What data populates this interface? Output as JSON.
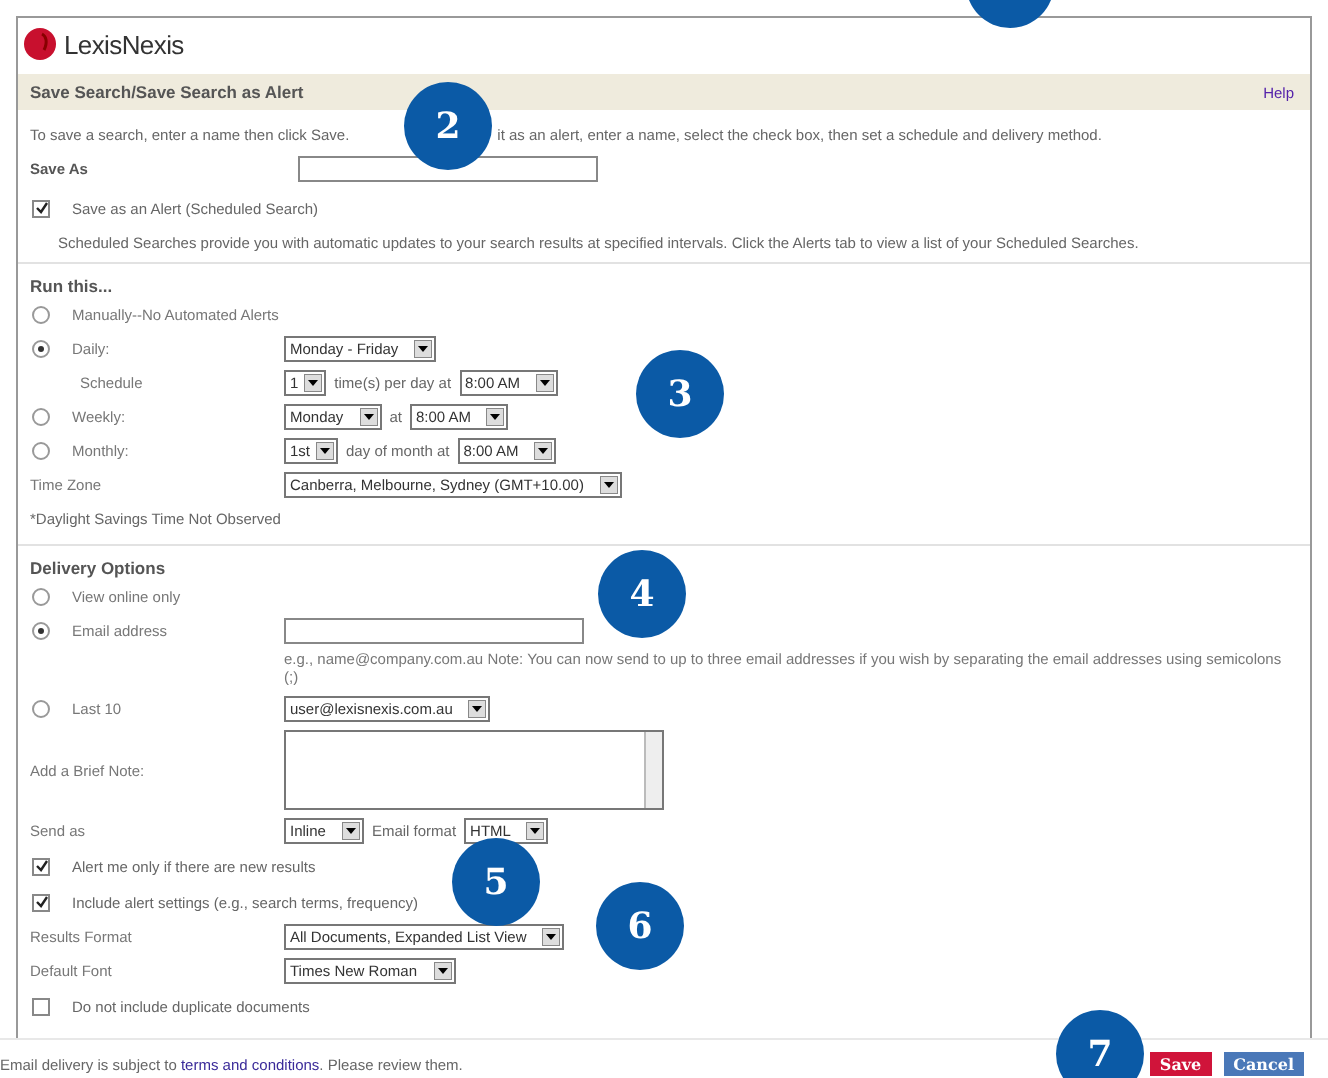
{
  "logo": {
    "text": "LexisNexis"
  },
  "header": {
    "title": "Save Search/Save Search as Alert",
    "help": "Help"
  },
  "intro": [
    "To save a search, enter a name then click Save.",
    "it as an alert, enter a name, select the check box, then set a schedule and delivery method."
  ],
  "save_as": {
    "label": "Save As"
  },
  "alert_checkbox": {
    "label": "Save as an Alert (Scheduled Search)",
    "checked": true
  },
  "alert_description": "Scheduled Searches provide you with automatic updates to your search results at specified intervals. Click the Alerts tab to view a list of your Scheduled Searches.",
  "run_this": {
    "heading": "Run this...",
    "rows": [
      {
        "kind": "radio",
        "label": "Manually--No Automated Alerts",
        "selected": false
      },
      {
        "kind": "radio",
        "label": "Daily:",
        "selected": true,
        "controls": [
          {
            "kind": "select",
            "value": "Monday - Friday"
          }
        ]
      },
      {
        "kind": "subfield",
        "label": "Schedule",
        "controls": [
          {
            "kind": "select",
            "value": "1"
          },
          {
            "kind": "text",
            "text": "time(s) per day at"
          },
          {
            "kind": "select",
            "value": "8:00 AM"
          }
        ]
      },
      {
        "kind": "radio",
        "label": "Weekly:",
        "selected": false,
        "controls": [
          {
            "kind": "select",
            "value": "Monday"
          },
          {
            "kind": "text",
            "text": "at"
          },
          {
            "kind": "select",
            "value": "8:00 AM"
          }
        ]
      },
      {
        "kind": "radio",
        "label": "Monthly:",
        "selected": false,
        "controls": [
          {
            "kind": "select",
            "value": "1st"
          },
          {
            "kind": "text",
            "text": "day of month at"
          },
          {
            "kind": "select",
            "value": "8:00 AM"
          }
        ]
      },
      {
        "kind": "field",
        "label": "Time Zone",
        "controls": [
          {
            "kind": "select",
            "value": "Canberra, Melbourne, Sydney (GMT+10.00)"
          }
        ]
      },
      {
        "kind": "note",
        "text": "*Daylight Savings Time Not Observed"
      }
    ]
  },
  "delivery": {
    "heading": "Delivery Options",
    "rows": [
      {
        "kind": "radio",
        "label": "View online only",
        "selected": false
      },
      {
        "kind": "radio",
        "label": "Email address",
        "selected": true,
        "controls": [
          {
            "kind": "input"
          }
        ]
      },
      {
        "kind": "hint",
        "text": "e.g., name@company.com.au Note: You can now send to up to three email addresses if you wish by separating the email addresses using semicolons (;)"
      },
      {
        "kind": "radio",
        "label": "Last 10",
        "selected": false,
        "controls": [
          {
            "kind": "select",
            "value": "user@lexisnexis.com.au"
          }
        ]
      },
      {
        "kind": "field",
        "label": "Add a Brief Note:",
        "controls": [
          {
            "kind": "textarea"
          }
        ]
      },
      {
        "kind": "field",
        "label": "Send as",
        "controls": [
          {
            "kind": "select",
            "value": "Inline"
          },
          {
            "kind": "text",
            "text": "Email format"
          },
          {
            "kind": "select",
            "value": "HTML"
          }
        ]
      },
      {
        "kind": "checkbox",
        "label": "Alert me only if there are new results",
        "checked": true
      },
      {
        "kind": "checkbox",
        "label": "Include alert settings (e.g., search terms, frequency)",
        "checked": true
      },
      {
        "kind": "field",
        "label": "Results Format",
        "controls": [
          {
            "kind": "select",
            "value": "All Documents, Expanded List View"
          }
        ]
      },
      {
        "kind": "field",
        "label": "Default Font",
        "controls": [
          {
            "kind": "select",
            "value": "Times New Roman"
          }
        ]
      },
      {
        "kind": "checkbox",
        "label": "Do not include duplicate documents",
        "checked": false
      }
    ]
  },
  "footer": {
    "text_before": "Email delivery is subject to",
    "link": "terms and conditions",
    "text_after": ". Please review them."
  },
  "buttons": [
    {
      "kind": "save",
      "label": "Save"
    },
    {
      "kind": "cancel",
      "label": "Cancel"
    }
  ],
  "callouts": [
    {
      "kind": "cut"
    },
    {
      "kind": "full",
      "number": "2"
    },
    {
      "kind": "full",
      "number": "3"
    },
    {
      "kind": "full",
      "number": "4"
    },
    {
      "kind": "full",
      "number": "5"
    },
    {
      "kind": "full",
      "number": "6"
    },
    {
      "kind": "full",
      "number": "7"
    }
  ]
}
